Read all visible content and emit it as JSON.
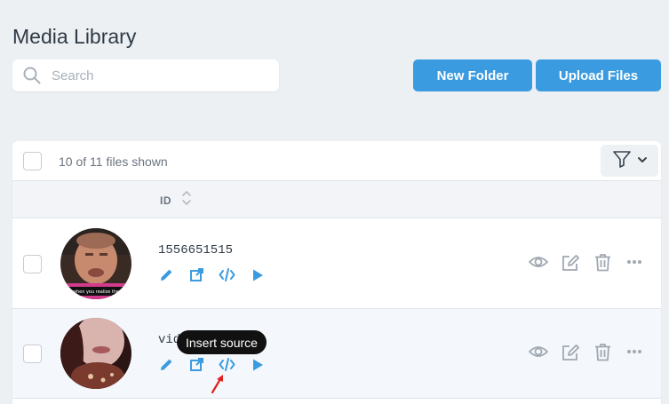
{
  "page": {
    "title": "Media Library"
  },
  "search": {
    "placeholder": "Search",
    "value": "",
    "icon": "search-icon"
  },
  "buttons": {
    "new_folder": "New Folder",
    "upload_files": "Upload Files"
  },
  "toolbar": {
    "files_shown": "10 of 11 files shown",
    "filter_icon": "filter-icon"
  },
  "table": {
    "columns": [
      "ID"
    ]
  },
  "rows": [
    {
      "id": "1556651515",
      "thumb_caption": "when you realize the"
    },
    {
      "id": "vid"
    }
  ],
  "tooltip": {
    "text": "Insert source"
  },
  "colors": {
    "accent": "#3b9be0",
    "icon_gray": "#a0a8b2",
    "tooltip_bg": "#111111",
    "pointer_arrow": "#e0201c"
  }
}
